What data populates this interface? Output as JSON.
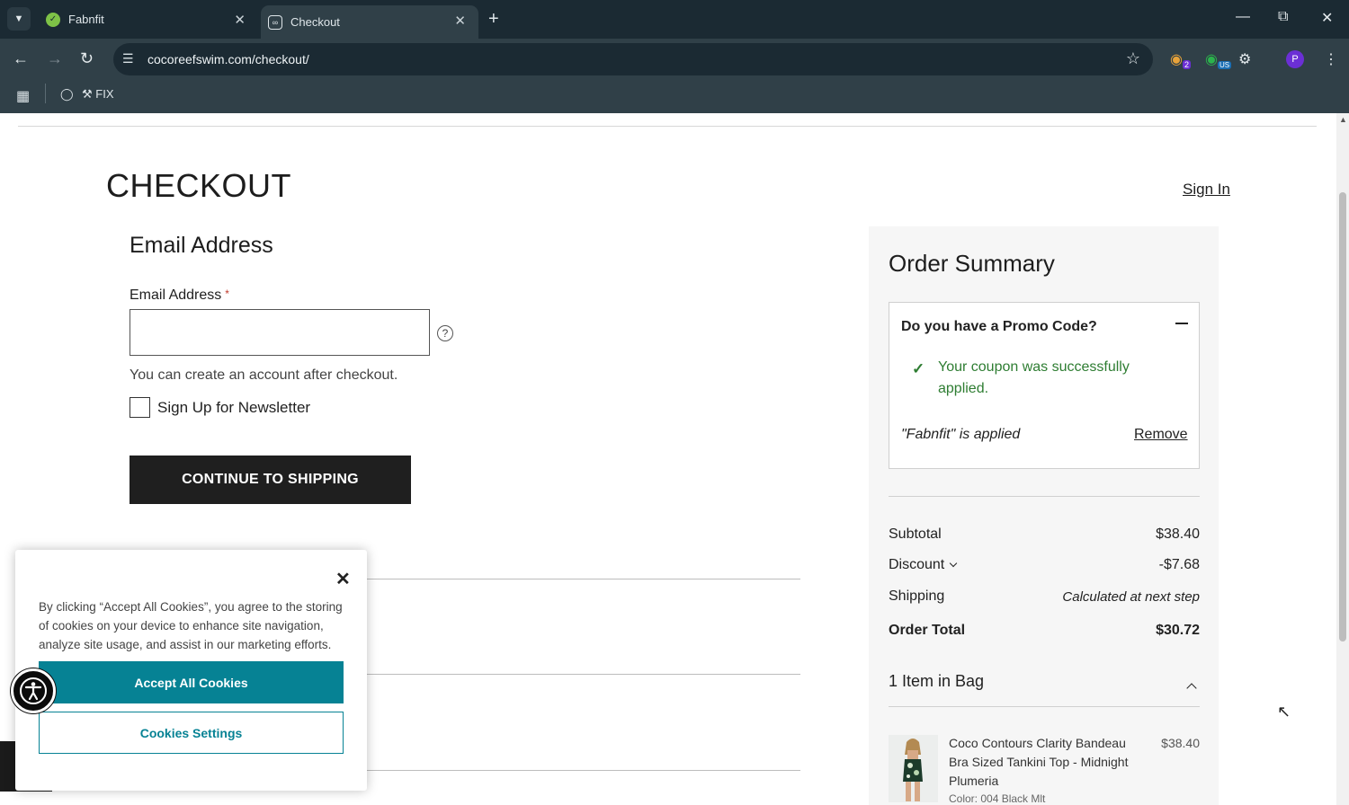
{
  "browser": {
    "tabs": [
      {
        "title": "Fabnfit",
        "active": false
      },
      {
        "title": "Checkout",
        "active": true
      }
    ],
    "url": "cocoreefswim.com/checkout/",
    "bookmarks": [
      {
        "label": "FIX"
      }
    ],
    "profile_initial": "P",
    "extension_badges": [
      "2",
      "US"
    ]
  },
  "page": {
    "title": "CHECKOUT",
    "sign_in": "Sign In"
  },
  "email_step": {
    "title": "Email Address",
    "label": "Email Address",
    "required_mark": "*",
    "value": "",
    "hint": "You can create an account after checkout.",
    "newsletter_label": "Sign Up for Newsletter",
    "newsletter_checked": false,
    "continue_label": "CONTINUE TO SHIPPING"
  },
  "summary": {
    "title": "Order Summary",
    "promo_question": "Do you have a Promo Code?",
    "coupon_message": "Your coupon was successfully applied.",
    "applied_text": "\"Fabnfit\" is applied",
    "remove_label": "Remove",
    "rows": [
      {
        "label": "Subtotal",
        "value": "$38.40"
      },
      {
        "label": "Discount",
        "value": "-$7.68"
      },
      {
        "label": "Shipping",
        "value": "Calculated at next step"
      },
      {
        "label": "Order Total",
        "value": "$30.72"
      }
    ],
    "bag_title": "1 Item in Bag",
    "items": [
      {
        "name": "Coco Contours Clarity Bandeau Bra Sized Tankini Top - Midnight Plumeria",
        "price": "$38.40",
        "color": "Color: 004 Black Mlt"
      }
    ]
  },
  "cookie_banner": {
    "text": "By clicking “Accept All Cookies”, you agree to the storing of cookies on your device to enhance site navigation, analyze site usage, and assist in our marketing efforts.",
    "accept_label": "Accept All Cookies",
    "settings_label": "Cookies Settings"
  },
  "colors": {
    "accent_teal": "#068294",
    "success_green": "#2e7d32",
    "browser_dark": "#1b2a33",
    "browser_toolbar": "#304048"
  }
}
